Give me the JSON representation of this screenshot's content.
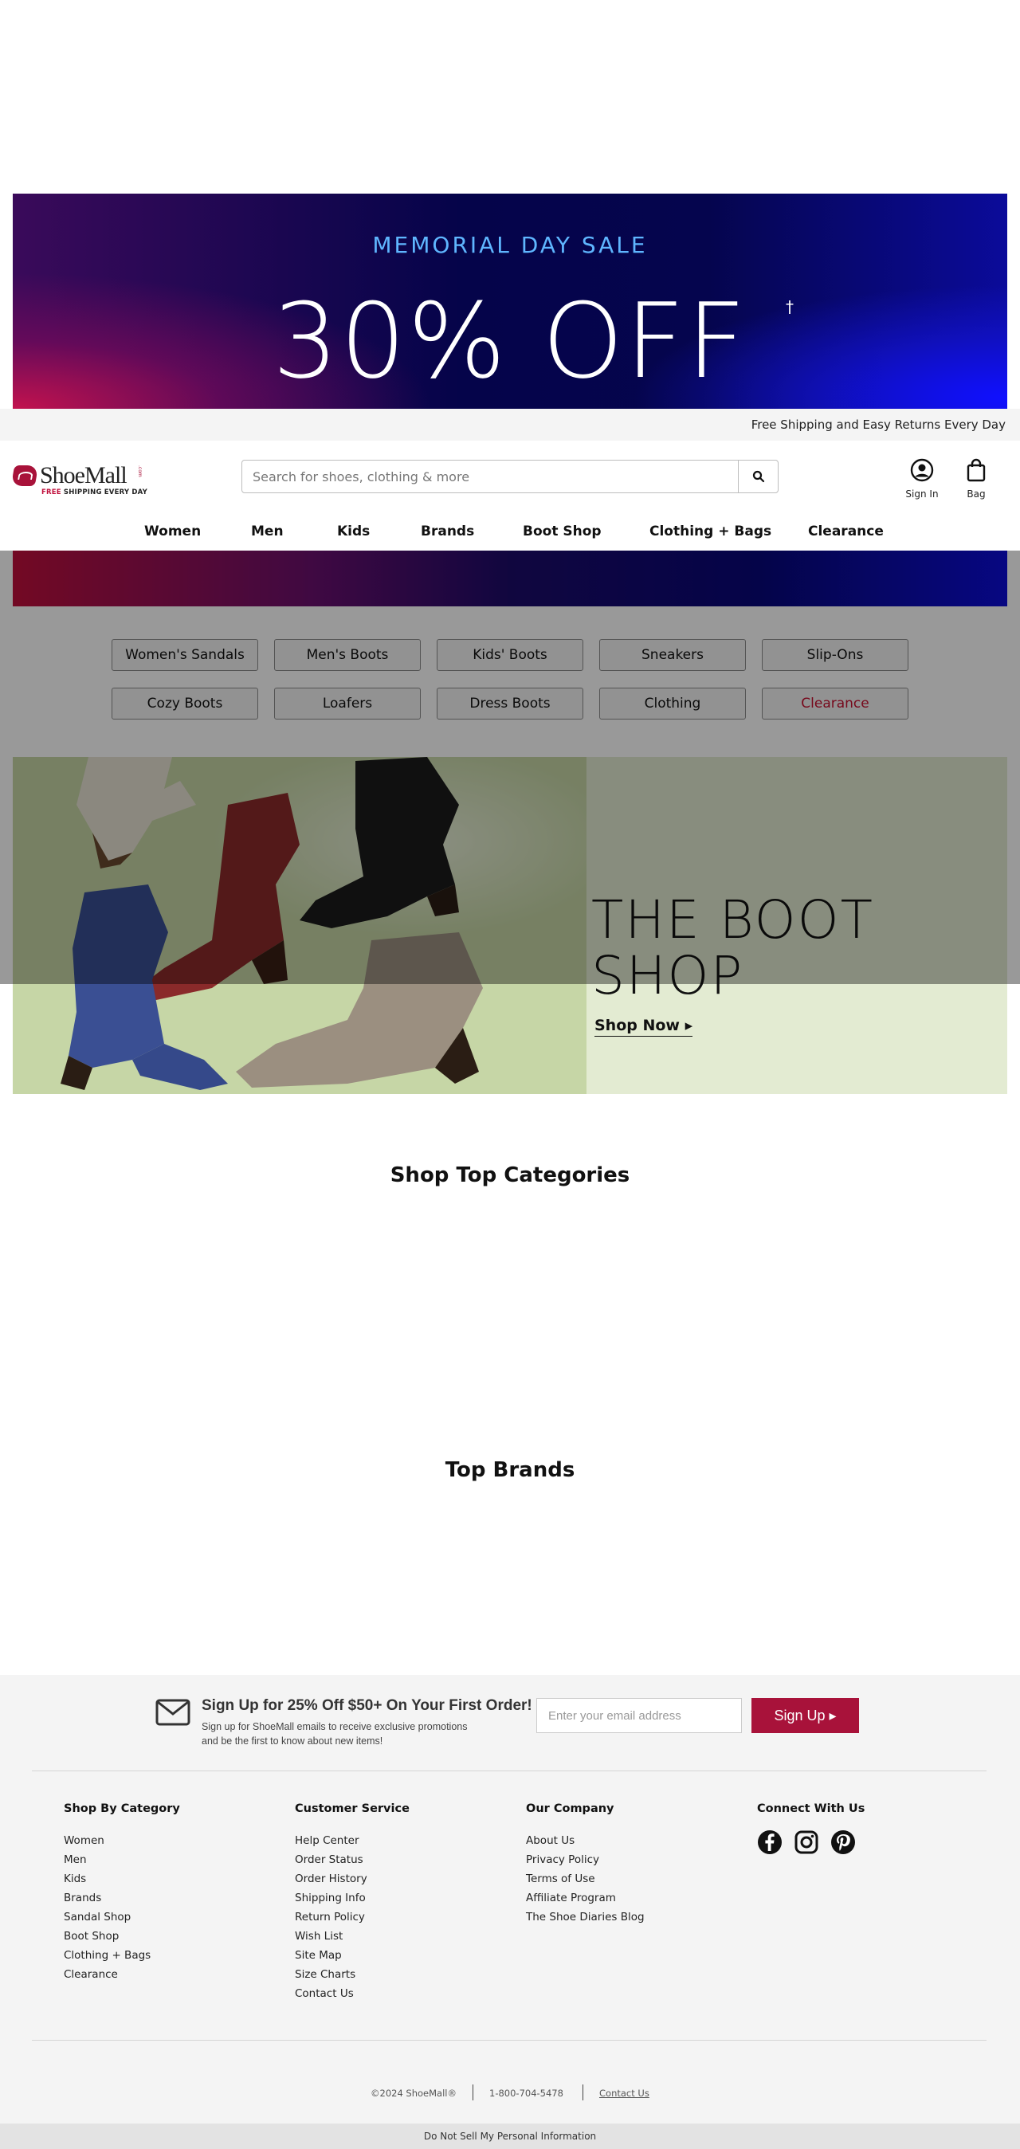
{
  "hero": {
    "eyebrow": "MEMORIAL DAY SALE",
    "headline": "30% OFF",
    "dagger": "†"
  },
  "shipping_bar": "Free Shipping and Easy Returns Every Day",
  "header": {
    "logo_text": "ShoeMall",
    "logo_tm": ".com",
    "logo_tag_free": "FREE",
    "logo_tag_rest": " SHIPPING EVERY DAY",
    "search_placeholder": "Search for shoes, clothing & more",
    "search_value": "",
    "sign_in_label": "Sign In",
    "bag_label": "Bag"
  },
  "nav": [
    "Women",
    "Men",
    "Kids",
    "Brands",
    "Boot Shop",
    "Clothing + Bags",
    "Clearance"
  ],
  "quick_categories": [
    [
      "Women's Sandals",
      "Men's Boots",
      "Kids' Boots",
      "Sneakers",
      "Slip-Ons"
    ],
    [
      "Cozy Boots",
      "Loafers",
      "Dress Boots",
      "Clothing",
      "Clearance"
    ]
  ],
  "boot_shop": {
    "headline_1": "THE BOOT",
    "headline_2": "SHOP",
    "cta": "Shop Now ▸"
  },
  "sections": {
    "top_categories": "Shop Top Categories",
    "top_brands": "Top Brands"
  },
  "footer": {
    "signup_title": "Sign Up for 25% Off $50+ On Your First Order!",
    "signup_sub_1": "Sign up for ShoeMall emails to receive exclusive promotions",
    "signup_sub_2": "and be the first to know about new items!",
    "email_placeholder": "Enter your email address",
    "email_value": "",
    "signup_button": "Sign Up ▸",
    "columns": [
      {
        "title": "Shop By Category",
        "links": [
          "Women",
          "Men",
          "Kids",
          "Brands",
          "Sandal Shop",
          "Boot Shop",
          "Clothing + Bags",
          "Clearance"
        ]
      },
      {
        "title": "Customer Service",
        "links": [
          "Help Center",
          "Order Status",
          "Order History",
          "Shipping Info",
          "Return Policy",
          "Wish List",
          "Site Map",
          "Size Charts",
          "Contact Us"
        ]
      },
      {
        "title": "Our Company",
        "links": [
          "About Us",
          "Privacy Policy",
          "Terms of Use",
          "Affiliate Program",
          "The Shoe Diaries Blog"
        ]
      }
    ],
    "social_title": "Connect With Us",
    "copyright": "©2024 ShoeMall®",
    "phone": "1-800-704-5478",
    "contact": "Contact Us",
    "do_not_sell": "Do Not Sell My Personal Information"
  },
  "colors": {
    "brand": "#a8123a",
    "clearance": "#c7102f"
  }
}
